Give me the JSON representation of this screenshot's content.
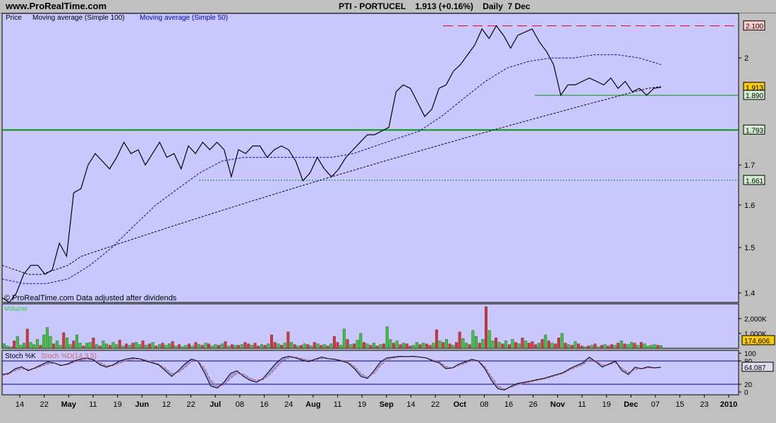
{
  "header": {
    "site": "www.ProRealTime.com",
    "instrument": "PTI - PORTUCEL",
    "last_change": "1.913 (+0.16%)",
    "period": "Daily",
    "date": "7 Dec"
  },
  "colors": {
    "panel_bg": "#c8c8ff",
    "price_line": "#000000",
    "ma100": "#000000",
    "ma50": "#0000c0",
    "green_line": "#009900",
    "red_line": "#e00000",
    "vol_up": "#33cc33",
    "vol_down": "#dd3333",
    "stoch_k": "#000000",
    "stoch_d": "#cc6666"
  },
  "chart_data": [
    {
      "type": "line",
      "panel": "price",
      "legend": [
        "Price",
        "Moving average (Simple 100)",
        "Moving average (Simple 50)"
      ],
      "footnote": "© ProRealTime.com Data adjusted after dividends",
      "y_axis": {
        "ticks": [
          1.4,
          1.5,
          1.6,
          1.7,
          2
        ],
        "scale": "log",
        "range": [
          1.38,
          2.14
        ]
      },
      "x_axis": {
        "labels": [
          "14",
          "22",
          "May",
          "11",
          "19",
          "Jun",
          "12",
          "22",
          "Jul",
          "08",
          "16",
          "24",
          "Aug",
          "11",
          "19",
          "Sep",
          "14",
          "22",
          "Oct",
          "08",
          "16",
          "26",
          "Nov",
          "11",
          "19",
          "Dec",
          "07",
          "15",
          "23",
          "2010"
        ],
        "bold_labels": [
          "May",
          "Jun",
          "Jul",
          "Aug",
          "Sep",
          "Oct",
          "Nov",
          "Dec",
          "2010"
        ]
      },
      "price_series": [
        1.39,
        1.38,
        1.4,
        1.44,
        1.46,
        1.46,
        1.44,
        1.45,
        1.51,
        1.48,
        1.63,
        1.64,
        1.7,
        1.73,
        1.71,
        1.69,
        1.72,
        1.76,
        1.73,
        1.74,
        1.7,
        1.73,
        1.76,
        1.72,
        1.73,
        1.69,
        1.75,
        1.73,
        1.76,
        1.74,
        1.76,
        1.74,
        1.67,
        1.74,
        1.73,
        1.75,
        1.75,
        1.72,
        1.74,
        1.75,
        1.74,
        1.71,
        1.66,
        1.68,
        1.72,
        1.69,
        1.67,
        1.69,
        1.72,
        1.74,
        1.76,
        1.78,
        1.78,
        1.79,
        1.8,
        1.9,
        1.92,
        1.91,
        1.87,
        1.83,
        1.85,
        1.91,
        1.92,
        1.96,
        1.98,
        2.01,
        2.04,
        2.09,
        2.06,
        2.1,
        2.07,
        2.03,
        2.07,
        2.08,
        2.09,
        2.05,
        2.02,
        1.98,
        1.89,
        1.92,
        1.92,
        1.93,
        1.94,
        1.93,
        1.92,
        1.94,
        1.91,
        1.93,
        1.9,
        1.91,
        1.89,
        1.91,
        1.913
      ],
      "ma100_series": [
        1.46,
        1.45,
        1.44,
        1.44,
        1.45,
        1.46,
        1.48,
        1.49,
        1.5,
        1.51,
        1.52,
        1.53,
        1.54,
        1.55,
        1.56,
        1.57,
        1.58,
        1.59,
        1.6,
        1.61,
        1.62,
        1.63,
        1.64,
        1.65,
        1.66,
        1.67,
        1.68,
        1.69,
        1.7,
        1.71,
        1.72,
        1.73,
        1.74,
        1.75,
        1.76,
        1.77,
        1.78,
        1.79,
        1.8,
        1.81,
        1.82,
        1.83,
        1.84,
        1.85,
        1.86,
        1.87,
        1.88,
        1.89,
        1.9,
        1.91,
        1.915
      ],
      "ma50_series": [
        1.43,
        1.42,
        1.42,
        1.43,
        1.46,
        1.5,
        1.55,
        1.6,
        1.64,
        1.68,
        1.71,
        1.72,
        1.72,
        1.72,
        1.72,
        1.72,
        1.73,
        1.75,
        1.77,
        1.79,
        1.83,
        1.88,
        1.93,
        1.97,
        1.99,
        2.0,
        2.0,
        2.01,
        2.01,
        2.0,
        1.98
      ],
      "horizontal_levels": [
        {
          "value": 2.1,
          "label": "2.100",
          "style": "dashed-red"
        },
        {
          "value": 1.913,
          "label": "1.913",
          "style": "last-price"
        },
        {
          "value": 1.89,
          "label": "1.890",
          "style": "solid-green"
        },
        {
          "value": 1.793,
          "label": "1.793",
          "style": "solid-green-thick"
        },
        {
          "value": 1.661,
          "label": "1.661",
          "style": "dotted-green"
        }
      ]
    },
    {
      "type": "bar",
      "panel": "volume",
      "title": "Volume",
      "y_axis": {
        "ticks": [
          "2,000K",
          "1,000K"
        ],
        "tick_values": [
          2000,
          1000
        ],
        "range": [
          0,
          2800
        ]
      },
      "last_label": "174,606",
      "values": [
        300,
        150,
        100,
        500,
        800,
        200,
        350,
        1300,
        400,
        250,
        600,
        200,
        900,
        1400,
        800,
        300,
        500,
        200,
        1050,
        700,
        250,
        500,
        900,
        350,
        150,
        350,
        400,
        700,
        250,
        150,
        500,
        300,
        200,
        400,
        250,
        550,
        150,
        300,
        200,
        350,
        400,
        250,
        500,
        200,
        300,
        400,
        150,
        250,
        350,
        200,
        300,
        450,
        150,
        250,
        100,
        200,
        300,
        150,
        400,
        250,
        200,
        350,
        300,
        150,
        250,
        200,
        300,
        450,
        150,
        250,
        200,
        200,
        250,
        400,
        300,
        200,
        350,
        150,
        250,
        200,
        300,
        900,
        400,
        300,
        200,
        350,
        1100,
        400,
        250,
        150,
        200,
        300,
        250,
        150,
        400,
        300,
        200,
        250,
        150,
        300,
        800,
        400,
        200,
        1300,
        600,
        250,
        300,
        550,
        1000,
        400,
        300,
        200,
        350,
        150,
        250,
        300,
        1450,
        600,
        350,
        500,
        250,
        350,
        300,
        150,
        200,
        400,
        250,
        350,
        300,
        200,
        350,
        1250,
        500,
        400,
        600,
        300,
        200,
        400,
        1100,
        650,
        350,
        250,
        1200,
        800,
        350,
        600,
        2800,
        1200,
        500,
        700,
        400,
        300,
        500,
        250,
        600,
        400,
        300,
        700,
        500,
        350,
        450,
        250,
        350,
        600,
        900,
        500,
        350,
        300,
        700,
        1000,
        350,
        250,
        200,
        450,
        300,
        150,
        100,
        150,
        200,
        300,
        100,
        200,
        250,
        150,
        250,
        200,
        350,
        500,
        300,
        250,
        400,
        350,
        200,
        400,
        300,
        150,
        200,
        250,
        200,
        175
      ],
      "colors_up": [
        true,
        true,
        true,
        false,
        true,
        true,
        true,
        false,
        true,
        true,
        true,
        false,
        true,
        true,
        true,
        false,
        true,
        true,
        false,
        true,
        true,
        false,
        true,
        true,
        false,
        true,
        true,
        false,
        true,
        false,
        true,
        true,
        false,
        true,
        true,
        false,
        true,
        false,
        true,
        false,
        true,
        true,
        false,
        true,
        false,
        true,
        false,
        true,
        false,
        true,
        true,
        false,
        true,
        false,
        true,
        true,
        false,
        true,
        false,
        true,
        false,
        true,
        false,
        true,
        true,
        false,
        true,
        false,
        true,
        false,
        true,
        false,
        true,
        false,
        false,
        true,
        false,
        false,
        true,
        false,
        true,
        false,
        false,
        true,
        false,
        true,
        false,
        true,
        false,
        true,
        false,
        true,
        false,
        true,
        false,
        true,
        false,
        true,
        false,
        true,
        false,
        false,
        true,
        true,
        false,
        true,
        false,
        true,
        true,
        false,
        true,
        false,
        true,
        false,
        true,
        false,
        true,
        true,
        false,
        true,
        false,
        true,
        false,
        false,
        true,
        true,
        false,
        true,
        false,
        false,
        true,
        false,
        true,
        false,
        true,
        false,
        true,
        false,
        false,
        true,
        true,
        false,
        true,
        true,
        false,
        true,
        false,
        true,
        true,
        false,
        true,
        false,
        true,
        false,
        true,
        false,
        true,
        false,
        true,
        false,
        false,
        false,
        true,
        false,
        true,
        false,
        true,
        false,
        false,
        true,
        false,
        true,
        false,
        true,
        false,
        false,
        true,
        false,
        true,
        false,
        true,
        false,
        true,
        false,
        false,
        true,
        false,
        true,
        false,
        true,
        true,
        false,
        true,
        false,
        true
      ]
    },
    {
      "type": "line",
      "panel": "stochastic",
      "title": "Stoch %K",
      "title2": "Stoch %D(14,3,5)",
      "y_axis": {
        "ticks": [
          "100",
          "80",
          "20",
          "0"
        ],
        "tick_values": [
          100,
          80,
          20,
          0
        ],
        "range": [
          0,
          100
        ]
      },
      "last_label": "64.087",
      "k_series": [
        45,
        48,
        60,
        65,
        55,
        62,
        70,
        78,
        75,
        68,
        72,
        80,
        85,
        88,
        83,
        70,
        64,
        70,
        80,
        85,
        88,
        86,
        80,
        75,
        70,
        55,
        40,
        55,
        72,
        85,
        80,
        50,
        15,
        10,
        25,
        48,
        55,
        40,
        30,
        25,
        35,
        55,
        75,
        88,
        92,
        88,
        82,
        78,
        85,
        90,
        86,
        84,
        80,
        75,
        60,
        40,
        35,
        55,
        78,
        88,
        90,
        92,
        91,
        92,
        90,
        88,
        80,
        75,
        60,
        62,
        72,
        78,
        84,
        80,
        60,
        30,
        8,
        5,
        15,
        22,
        25,
        28,
        32,
        35,
        40,
        45,
        50,
        60,
        68,
        75,
        90,
        78,
        64,
        72,
        80,
        55,
        45,
        64,
        60,
        65,
        62,
        64
      ],
      "d_series": [
        42,
        46,
        55,
        60,
        58,
        60,
        66,
        72,
        74,
        70,
        70,
        76,
        82,
        85,
        84,
        76,
        68,
        68,
        74,
        80,
        84,
        86,
        83,
        78,
        72,
        62,
        48,
        50,
        62,
        78,
        80,
        62,
        30,
        15,
        18,
        35,
        48,
        46,
        36,
        30,
        32,
        44,
        62,
        80,
        88,
        90,
        86,
        82,
        83,
        86,
        86,
        85,
        82,
        78,
        66,
        48,
        38,
        48,
        68,
        82,
        88,
        90,
        91,
        91,
        90,
        88,
        83,
        78,
        66,
        62,
        68,
        74,
        80,
        80,
        66,
        40,
        16,
        8,
        12,
        18,
        22,
        26,
        30,
        33,
        38,
        43,
        48,
        56,
        64,
        70,
        82,
        80,
        70,
        70,
        76,
        62,
        50,
        58,
        60,
        62,
        62,
        63
      ]
    }
  ]
}
